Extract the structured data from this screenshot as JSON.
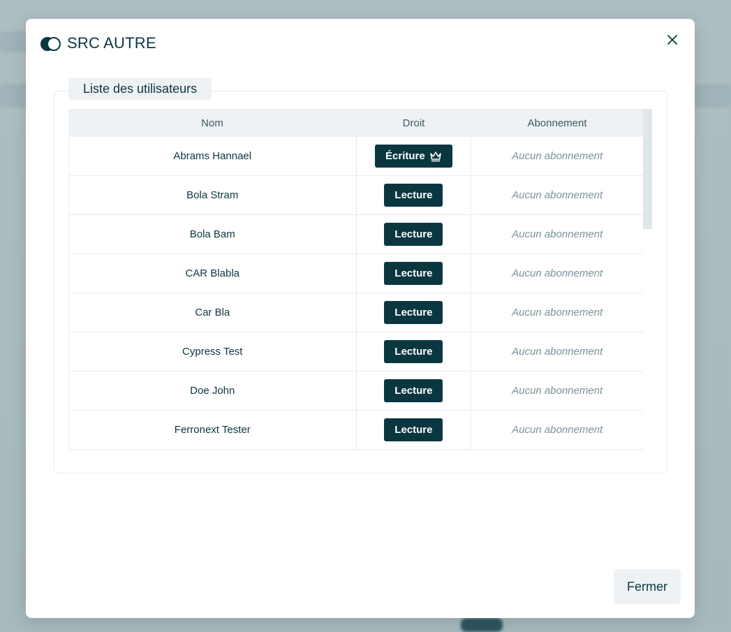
{
  "modal": {
    "title": "SRC AUTRE",
    "close_icon": "close-icon",
    "logo_icon": "overlapping-circles-logo-icon"
  },
  "section": {
    "legend": "Liste des utilisateurs"
  },
  "table": {
    "headers": [
      "Nom",
      "Droit",
      "Abonnement"
    ],
    "rows": [
      {
        "nom": "Abrams Hannael",
        "droit": "Écriture",
        "owner": true,
        "abonnement": "Aucun abonnement"
      },
      {
        "nom": "Bola Stram",
        "droit": "Lecture",
        "owner": false,
        "abonnement": "Aucun abonnement"
      },
      {
        "nom": "Bola Bam",
        "droit": "Lecture",
        "owner": false,
        "abonnement": "Aucun abonnement"
      },
      {
        "nom": "CAR Blabla",
        "droit": "Lecture",
        "owner": false,
        "abonnement": "Aucun abonnement"
      },
      {
        "nom": "Car Bla",
        "droit": "Lecture",
        "owner": false,
        "abonnement": "Aucun abonnement"
      },
      {
        "nom": "Cypress Test",
        "droit": "Lecture",
        "owner": false,
        "abonnement": "Aucun abonnement"
      },
      {
        "nom": "Doe John",
        "droit": "Lecture",
        "owner": false,
        "abonnement": "Aucun abonnement"
      },
      {
        "nom": "Ferronext Tester",
        "droit": "Lecture",
        "owner": false,
        "abonnement": "Aucun abonnement"
      }
    ]
  },
  "footer": {
    "close_label": "Fermer"
  },
  "colors": {
    "primary": "#0a3640",
    "muted": "#7a9299",
    "header_bg": "#eef2f4"
  }
}
